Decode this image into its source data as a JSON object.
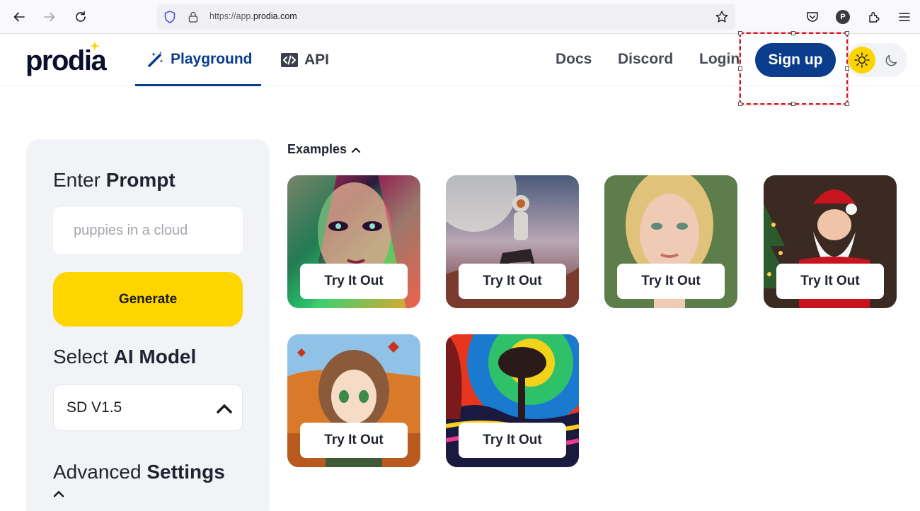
{
  "browser": {
    "url_prefix": "https://app.",
    "url_domain": "prodia.com",
    "profile_initial": "P",
    "icons": [
      "back-arrow-icon",
      "forward-arrow-icon",
      "reload-icon",
      "shield-icon",
      "lock-icon",
      "bookmark-star-icon",
      "pocket-icon",
      "extensions-icon",
      "menu-icon"
    ]
  },
  "header": {
    "logo": "prodia",
    "tabs": [
      {
        "label": "Playground",
        "icon": "magic-wand-icon",
        "active": true
      },
      {
        "label": "API",
        "icon": "code-icon",
        "active": false
      }
    ],
    "links": [
      "Docs",
      "Discord",
      "Login"
    ],
    "signup_label": "Sign up",
    "theme": {
      "light_icon": "sun-icon",
      "dark_icon": "moon-icon",
      "active": "light"
    }
  },
  "sidebar": {
    "prompt_title_light": "Enter ",
    "prompt_title_bold": "Prompt",
    "prompt_placeholder": "puppies in a cloud",
    "generate_label": "Generate",
    "model_title_light": "Select ",
    "model_title_bold": "AI Model",
    "model_value": "SD V1.5",
    "advanced_light": "Advanced ",
    "advanced_bold": "Settings"
  },
  "examples": {
    "title": "Examples",
    "cards": [
      {
        "name": "neon-woman",
        "button": "Try It Out"
      },
      {
        "name": "astronaut-horse",
        "button": "Try It Out"
      },
      {
        "name": "blonde-portrait",
        "button": "Try It Out"
      },
      {
        "name": "santa",
        "button": "Try It Out"
      },
      {
        "name": "anime-autumn-girl",
        "button": "Try It Out"
      },
      {
        "name": "psychedelic-tree",
        "button": "Try It Out"
      }
    ]
  },
  "colors": {
    "brand_blue": "#0b3d8c",
    "accent_yellow": "#ffd500",
    "sidebar_bg": "#f1f3f6",
    "selection_red": "#d0161c"
  }
}
